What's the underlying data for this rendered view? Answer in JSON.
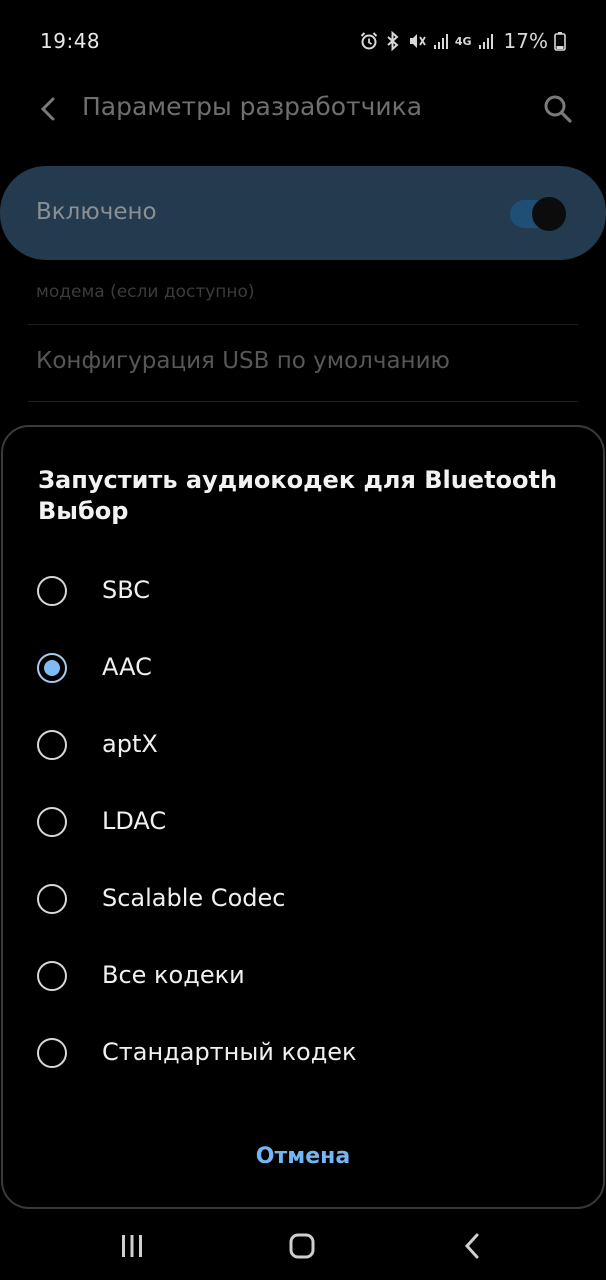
{
  "status_bar": {
    "time": "19:48",
    "network": "4G",
    "battery": "17%"
  },
  "header": {
    "title": "Параметры разработчика"
  },
  "master_switch": {
    "label": "Включено",
    "state": "on",
    "accent_color": "#243a4e"
  },
  "background_list": {
    "fragment_text": "модема (если доступно)",
    "item_label": "Конфигурация USB по умолчанию"
  },
  "dialog": {
    "title": "Запустить аудиокодек для Bluetooth Выбор",
    "options": [
      {
        "label": "SBC",
        "selected": false
      },
      {
        "label": "AAC",
        "selected": true
      },
      {
        "label": "aptX",
        "selected": false
      },
      {
        "label": "LDAC",
        "selected": false
      },
      {
        "label": "Scalable Codec",
        "selected": false
      },
      {
        "label": "Все кодеки",
        "selected": false
      },
      {
        "label": "Стандартный кодек",
        "selected": false
      }
    ],
    "cancel_label": "Отмена",
    "accent_color": "#74b6f4"
  },
  "nav_bar": {
    "icons": [
      "recent-apps-icon",
      "home-icon",
      "back-icon"
    ]
  }
}
